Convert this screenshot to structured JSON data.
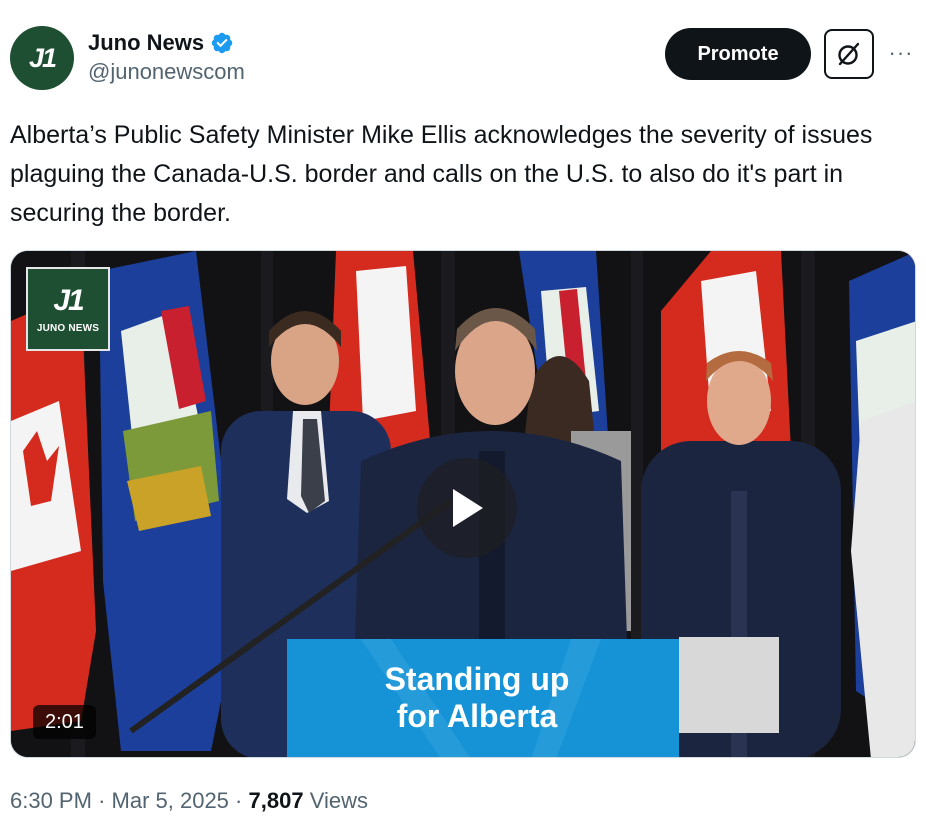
{
  "author": {
    "avatar_text": "J1",
    "display_name": "Juno News",
    "handle": "@junonewscom",
    "verified": true,
    "verified_color": "#1d9bf0"
  },
  "actions": {
    "promote_label": "Promote",
    "grok_icon": "grok-icon",
    "more_icon": "more-icon",
    "more_glyph": "···"
  },
  "tweet": {
    "text": "Alberta’s Public Safety Minister Mike Ellis acknowledges the severity of issues plaguing the Canada-U.S. border and calls on the U.S. to also do it's part in securing the border."
  },
  "media": {
    "type": "video",
    "watermark_glyph": "J1",
    "watermark_caption": "JUNO NEWS",
    "podium_line1": "Standing up",
    "podium_line2": "for Alberta",
    "duration": "2:01"
  },
  "meta": {
    "time": "6:30 PM",
    "separator": "·",
    "date": "Mar 5, 2025",
    "views_count": "7,807",
    "views_label": "Views"
  },
  "colors": {
    "brand_green": "#1f4f32",
    "text_primary": "#0f1419",
    "text_secondary": "#536471",
    "podium_blue": "#1593d6"
  }
}
